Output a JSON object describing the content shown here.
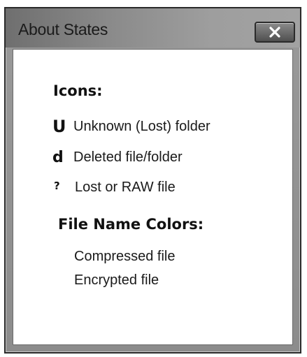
{
  "window": {
    "title": "About States"
  },
  "icons_section": {
    "heading": "Icons:",
    "items": [
      {
        "glyph": "U",
        "icon_name": "unknown-lost-folder-icon",
        "label": "Unknown (Lost) folder"
      },
      {
        "glyph": "d",
        "icon_name": "deleted-file-folder-icon",
        "label": "Deleted file/folder"
      },
      {
        "glyph": "?",
        "icon_name": "lost-raw-file-icon",
        "label": "Lost or RAW file"
      }
    ]
  },
  "colors_section": {
    "heading": "File Name Colors:",
    "items": [
      {
        "label": "Compressed file"
      },
      {
        "label": "Encrypted file"
      }
    ]
  }
}
